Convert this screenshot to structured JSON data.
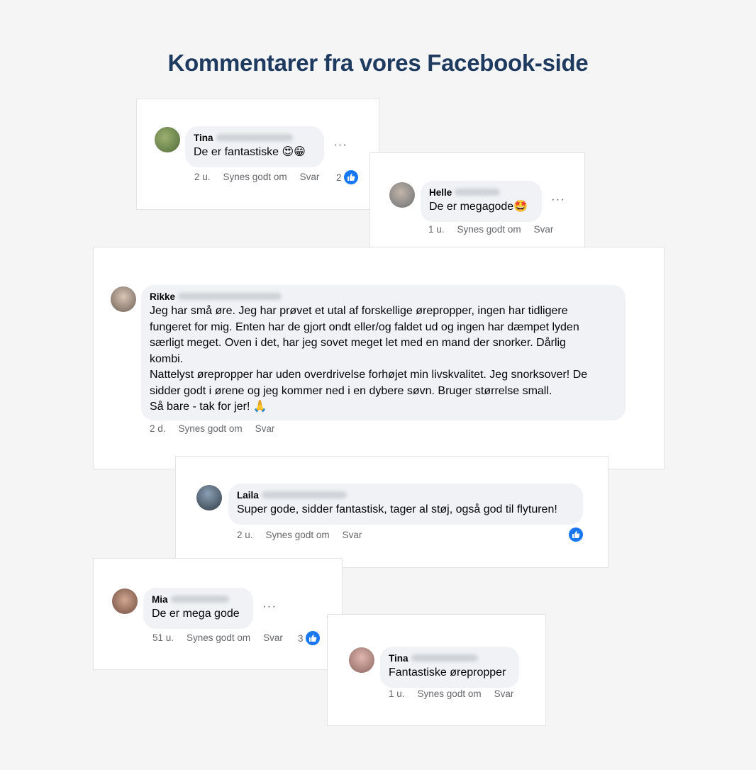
{
  "title": "Kommentarer fra vores Facebook-side",
  "comments": [
    {
      "first_name": "Tina",
      "lines": [
        "De er fantastiske 😍😁"
      ],
      "time": "2 u.",
      "like": "Synes godt om",
      "reply": "Svar",
      "reactions": "2",
      "avatar_color": "#6e8a4e"
    },
    {
      "first_name": "Helle",
      "lines": [
        "De er megagode🤩"
      ],
      "time": "1 u.",
      "like": "Synes godt om",
      "reply": "Svar",
      "avatar_color": "#8a8f96"
    },
    {
      "first_name": "Rikke",
      "lines": [
        "Jeg har små øre. Jeg har prøvet et utal af forskellige ørepropper, ingen har tidligere",
        "fungeret for mig. Enten har de gjort ondt eller/og faldet ud og ingen har dæmpet lyden",
        "særligt meget. Oven i det, har jeg sovet meget let med en mand der snorker. Dårlig",
        "kombi.",
        "Nattelyst ørepropper har uden overdrivelse forhøjet min livskvalitet. Jeg snorksover! De",
        "sidder godt i ørene og jeg kommer ned i en dybere søvn. Bruger størrelse small.",
        "Så bare - tak for jer! 🙏"
      ],
      "time": "2 d.",
      "like": "Synes godt om",
      "reply": "Svar",
      "avatar_color": "#9c8d80"
    },
    {
      "first_name": "Laila",
      "lines": [
        "Super gode, sidder fantastisk, tager al støj, også god til flyturen!"
      ],
      "time": "2 u.",
      "like": "Synes godt om",
      "reply": "Svar",
      "avatar_color": "#4d5d6e"
    },
    {
      "first_name": "Mia",
      "lines": [
        "De er mega gode"
      ],
      "time": "51 u.",
      "like": "Synes godt om",
      "reply": "Svar",
      "reactions": "3",
      "avatar_color": "#8a6f62"
    },
    {
      "first_name": "Tina",
      "lines": [
        "Fantastiske ørepropper"
      ],
      "time": "1 u.",
      "like": "Synes godt om",
      "reply": "Svar",
      "avatar_color": "#b08a86"
    }
  ],
  "colors": {
    "like_blue": "#1877f2",
    "bubble_bg": "#f0f2f5",
    "title": "#1e3a5f"
  },
  "icons": {
    "reaction": "thumbs-up-icon",
    "more": "more-options-icon"
  }
}
